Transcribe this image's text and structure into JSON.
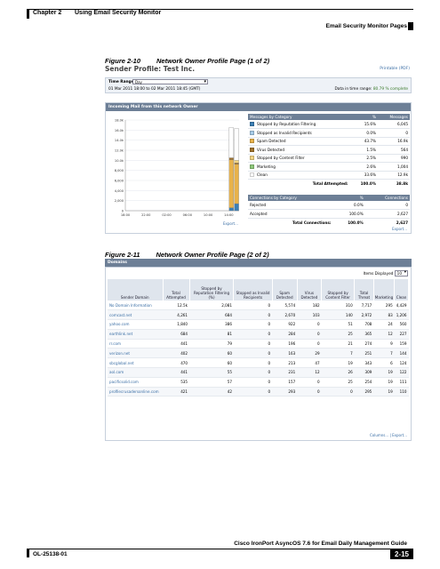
{
  "header": {
    "chapter": "Chapter 2",
    "chapter_title": "Using Email Security Monitor",
    "section": "Email Security Monitor Pages"
  },
  "figure1": {
    "number": "Figure 2-10",
    "title": "Network Owner Profile Page (1 of 2)",
    "sender_title": "Sender Profile: Test Inc.",
    "printable_link": "Printable (PDF)",
    "time_range_label": "Time Range:",
    "time_range_value": "Day",
    "date_range": "01 Mar 2011 18:00 to 02 Mar 2011 18:45 (GMT)",
    "data_in_range_prefix": "Data in time range:",
    "data_in_range_value": "80.79 % complete",
    "incoming_bar": "Incoming Mail from this network Owner",
    "export_label": "Export...",
    "messages_table": {
      "headers": [
        "Messages by Category",
        "%",
        "Messages"
      ],
      "rows": [
        {
          "label": "Stopped by Reputation Filtering",
          "pct": "15.6%",
          "count": "6,045",
          "color": "#3b7fb5"
        },
        {
          "label": "Stopped as Invalid Recipients",
          "pct": "0.0%",
          "count": "0",
          "color": "#a6cbe8"
        },
        {
          "label": "Spam Detected",
          "pct": "43.7%",
          "count": "16.9k",
          "color": "#e8b24a"
        },
        {
          "label": "Virus Detected",
          "pct": "1.5%",
          "count": "564",
          "color": "#a0732c"
        },
        {
          "label": "Stopped by Content Filter",
          "pct": "2.5%",
          "count": "990",
          "color": "#f2d584"
        },
        {
          "label": "Marketing",
          "pct": "2.6%",
          "count": "1,004",
          "color": "#8ec97a"
        },
        {
          "label": "Clean",
          "pct": "33.6%",
          "count": "12.9k",
          "color": "#ffffff"
        }
      ],
      "total_label": "Total Attempted:",
      "total_pct": "100.0%",
      "total_count": "38.8k"
    },
    "connections_table": {
      "headers": [
        "Connections by Category",
        "%",
        "Connections"
      ],
      "rows": [
        {
          "label": "Rejected",
          "pct": "0.0%",
          "count": "0"
        },
        {
          "label": "Accepted",
          "pct": "100.0%",
          "count": "2,627"
        }
      ],
      "total_label": "Total Connections:",
      "total_pct": "100.0%",
      "total_count": "2,627",
      "export_label": "Export..."
    },
    "chart_data": {
      "type": "bar",
      "y_ticks": [
        "18.0k",
        "16.0k",
        "14.0k",
        "12.0k",
        "10.0k",
        "8,000",
        "6,000",
        "4,000",
        "2,000",
        "0"
      ],
      "x_ticks": [
        "18:00",
        "20:00",
        "22:00",
        "00:00",
        "02:00",
        "04:00",
        "06:00",
        "08:00",
        "10:00",
        "12:00",
        "14:00",
        "16:00"
      ],
      "ylim": [
        0,
        18000
      ],
      "bars": [
        {
          "x": "14:30",
          "segments": [
            {
              "value": 600,
              "color": "#3b7fb5"
            },
            {
              "value": 9500,
              "color": "#e8b24a"
            },
            {
              "value": 400,
              "color": "#a0732c"
            },
            {
              "value": 6000,
              "color": "#ffffff"
            }
          ]
        },
        {
          "x": "15:30",
          "segments": [
            {
              "value": 1400,
              "color": "#3b7fb5"
            },
            {
              "value": 7800,
              "color": "#e8b24a"
            },
            {
              "value": 300,
              "color": "#a0732c"
            },
            {
              "value": 500,
              "color": "#f2d584"
            },
            {
              "value": 6300,
              "color": "#ffffff"
            }
          ]
        }
      ]
    }
  },
  "figure2": {
    "number": "Figure 2-11",
    "title": "Network Owner Profile Page (2 of 2)",
    "domains_bar": "Domains",
    "items_displayed_label": "Items Displayed",
    "items_displayed_value": "10",
    "columns": [
      "Sender Domain",
      "Total Attempted",
      "Stopped by Reputation Filtering (%)",
      "Stopped as Invalid Recipients",
      "Spam Detected",
      "Virus Detected",
      "Stopped by Content Filter",
      "Total Threat",
      "Marketing",
      "Clean"
    ],
    "rows": [
      [
        "No Domain Information",
        "12.5k",
        "2,081",
        "0",
        "5,574",
        "182",
        "310",
        "7,717",
        "295",
        "4,429"
      ],
      [
        "comcast.net",
        "4,261",
        "684",
        "0",
        "2,670",
        "103",
        "140",
        "2,972",
        "83",
        "1,206"
      ],
      [
        "yahoo.com",
        "1,840",
        "386",
        "0",
        "922",
        "0",
        "51",
        "708",
        "24",
        "560"
      ],
      [
        "earthlink.net",
        "684",
        "81",
        "0",
        "284",
        "0",
        "25",
        "365",
        "12",
        "227"
      ],
      [
        "rr.com",
        "441",
        "79",
        "0",
        "196",
        "0",
        "21",
        "274",
        "9",
        "159"
      ],
      [
        "verizon.net",
        "402",
        "60",
        "0",
        "163",
        "29",
        "7",
        "251",
        "7",
        "144"
      ],
      [
        "sbcglobal.net",
        "470",
        "60",
        "0",
        "213",
        "47",
        "19",
        "343",
        "6",
        "124"
      ],
      [
        "aol.com",
        "441",
        "55",
        "0",
        "231",
        "12",
        "26",
        "309",
        "19",
        "122"
      ],
      [
        "pacificsolid.com",
        "535",
        "57",
        "0",
        "157",
        "0",
        "25",
        "254",
        "19",
        "111"
      ],
      [
        "profilecrusadersonline.com",
        "421",
        "42",
        "0",
        "293",
        "0",
        "0",
        "295",
        "19",
        "110"
      ]
    ],
    "links": "Columns... | Export..."
  },
  "footer": {
    "book": "Cisco IronPort AsyncOS 7.6 for Email Daily Management Guide",
    "doc_number": "OL-25138-01",
    "page": "2-15"
  }
}
